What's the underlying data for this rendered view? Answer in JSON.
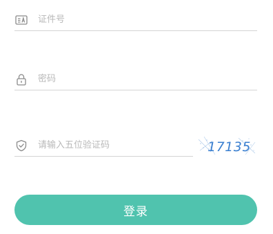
{
  "form": {
    "id_field": {
      "icon": "id-card-icon",
      "placeholder": "证件号",
      "value": ""
    },
    "password_field": {
      "icon": "lock-icon",
      "placeholder": "密码",
      "value": ""
    },
    "captcha_field": {
      "icon": "shield-check-icon",
      "placeholder": "请输入五位验证码",
      "value": ""
    },
    "captcha_image": {
      "text": "17135"
    },
    "login_button_label": "登录"
  },
  "colors": {
    "accent": "#50c3ae",
    "icon": "#8a8a8a",
    "placeholder": "#b9b9b9",
    "divider": "#d4d4d4",
    "captcha_text": "#3a7fd0"
  }
}
